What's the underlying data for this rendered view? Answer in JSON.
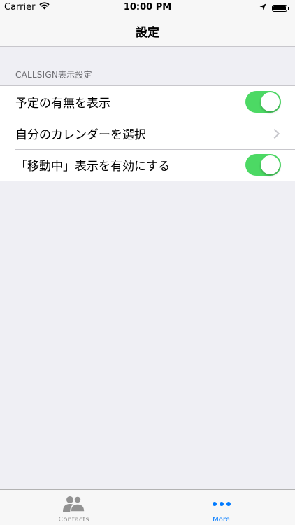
{
  "status_bar": {
    "carrier": "Carrier",
    "time": "10:00 PM"
  },
  "nav": {
    "title": "設定"
  },
  "section": {
    "header": "CALLSIGN表示設定",
    "rows": [
      {
        "label": "予定の有無を表示",
        "accessory": "switch",
        "on": true
      },
      {
        "label": "自分のカレンダーを選択",
        "accessory": "chevron"
      },
      {
        "label": "「移動中」表示を有効にする",
        "accessory": "switch",
        "on": true
      }
    ]
  },
  "tab_bar": {
    "tabs": [
      {
        "label": "Contacts",
        "icon": "contacts-icon",
        "active": false
      },
      {
        "label": "More",
        "icon": "more-icon",
        "active": true
      }
    ]
  },
  "colors": {
    "switch_on": "#4cd964",
    "accent": "#007aff",
    "background": "#efeff4"
  }
}
